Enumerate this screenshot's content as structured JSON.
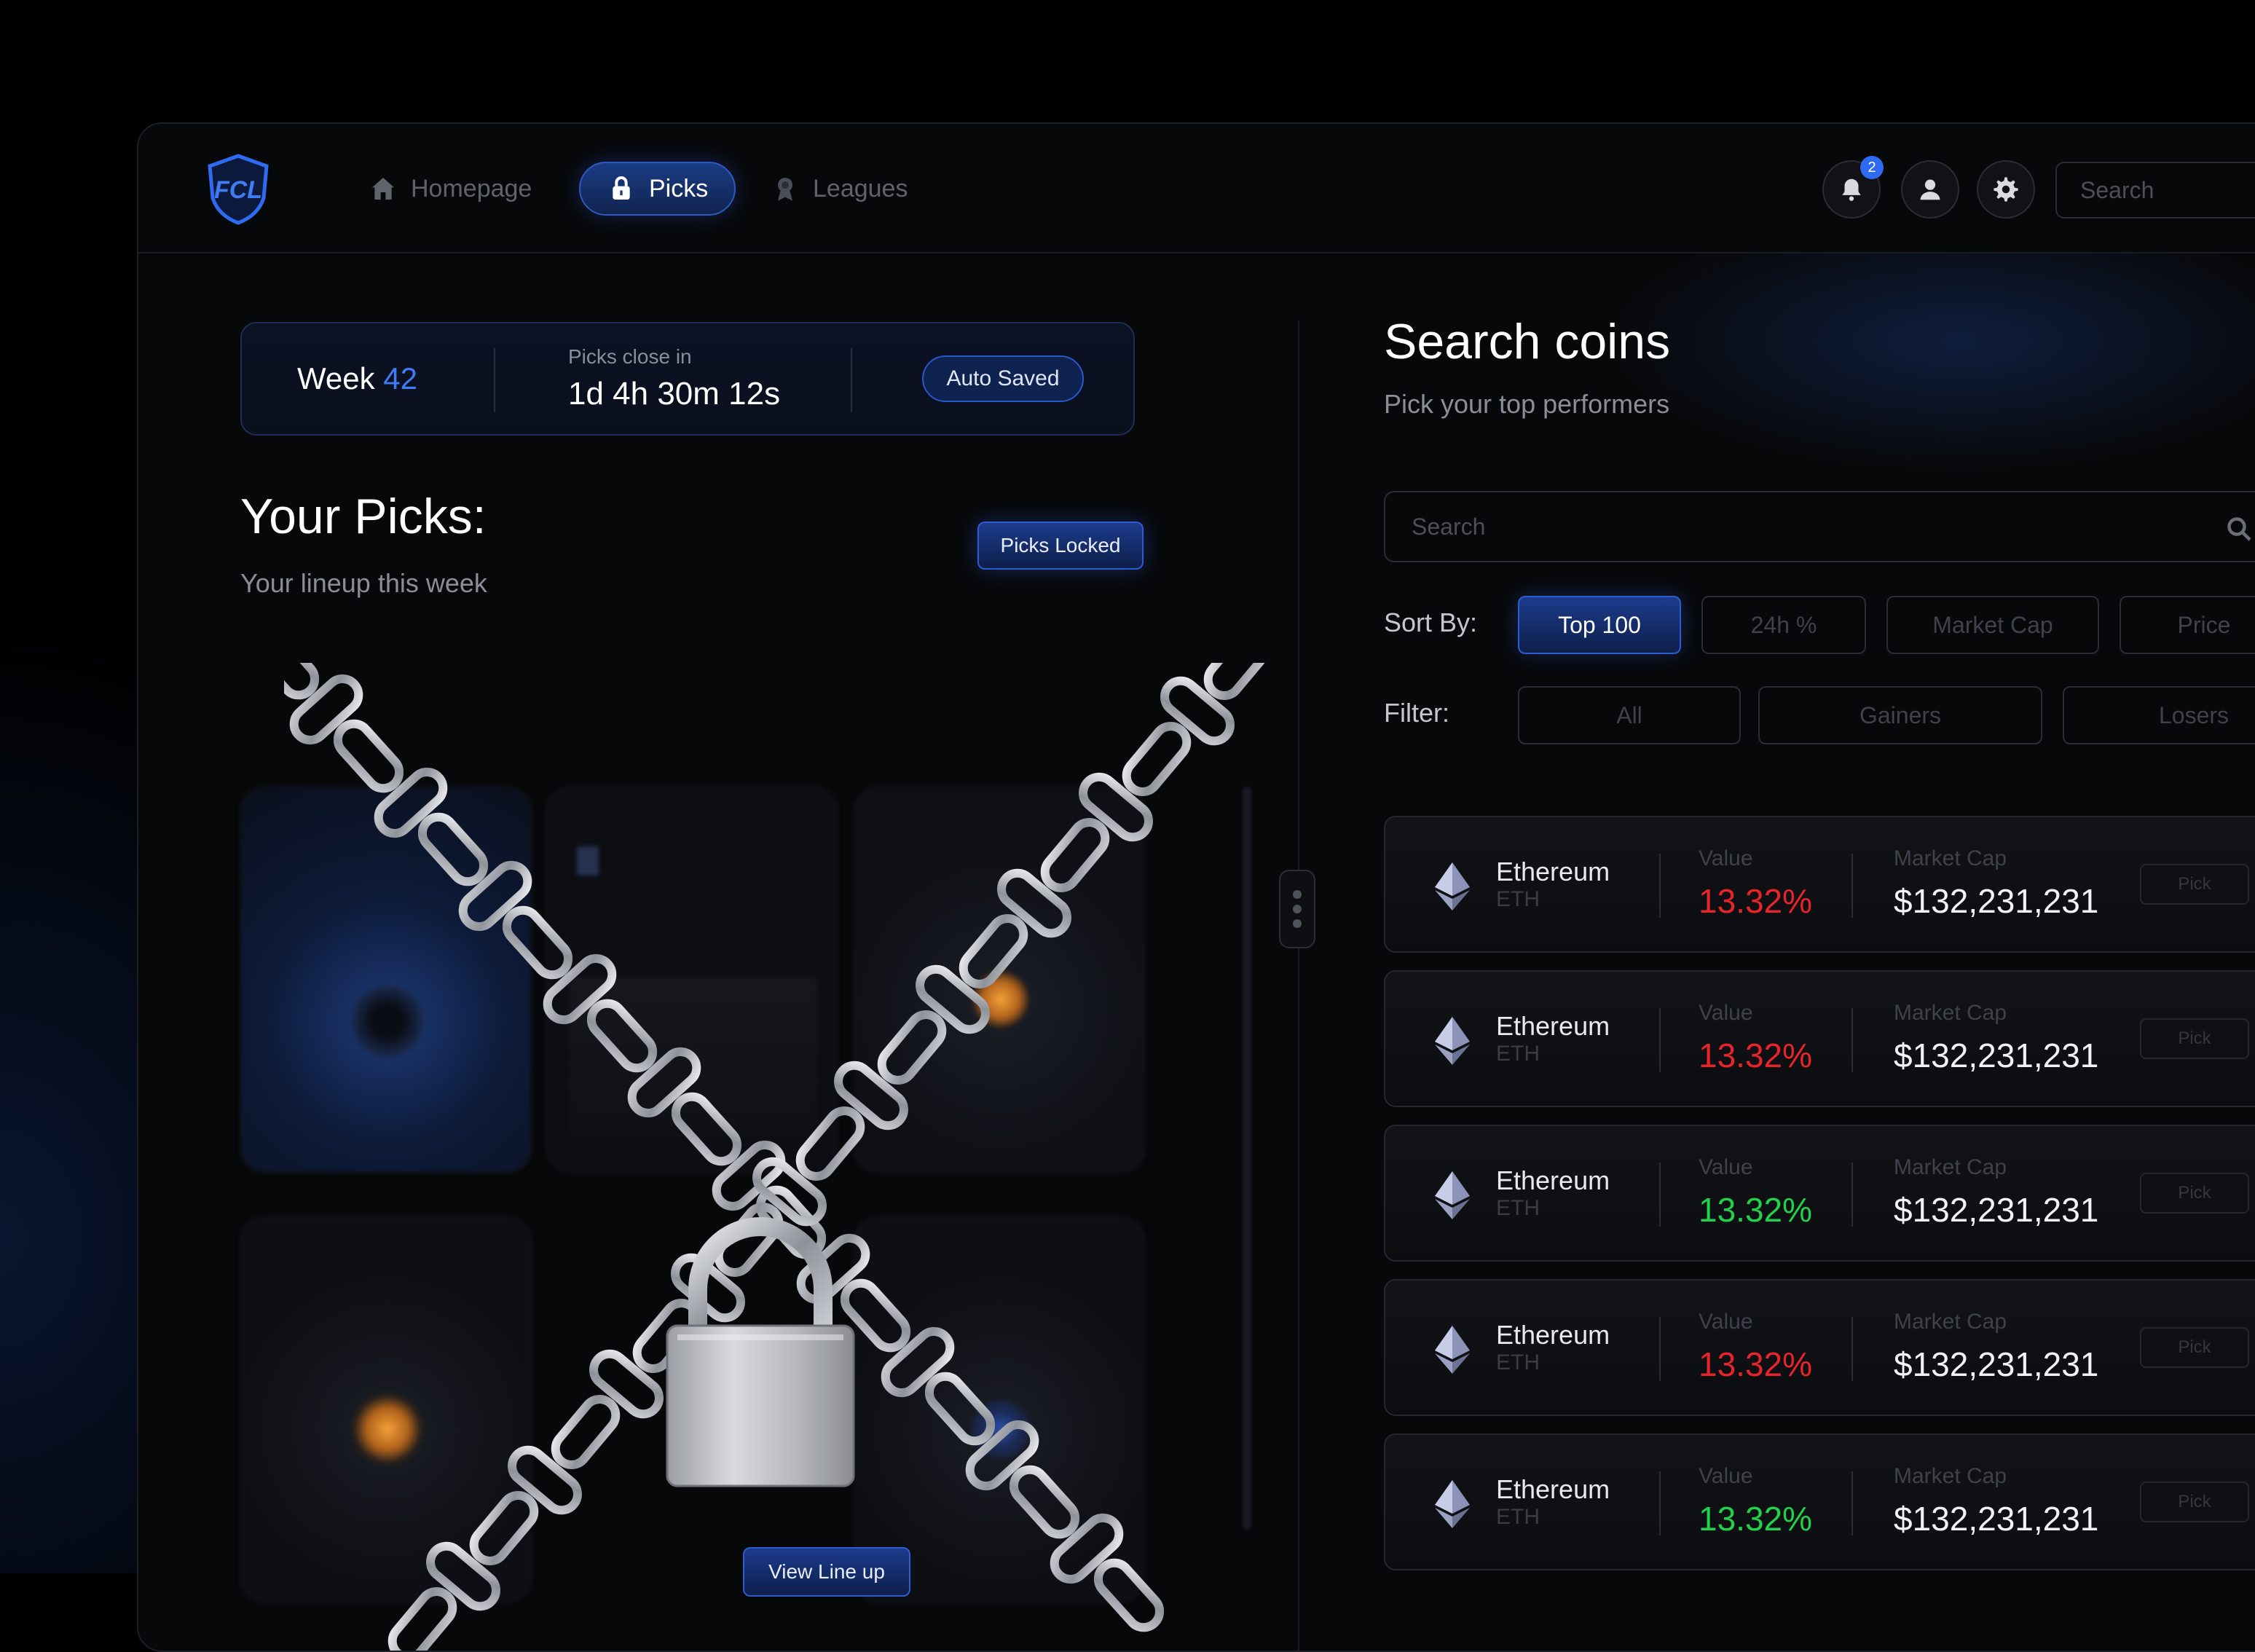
{
  "app": {
    "logo_text": "FCL",
    "brand_color": "#2f6bf2"
  },
  "nav": {
    "items": [
      {
        "label": "Homepage",
        "icon": "home-icon",
        "active": false
      },
      {
        "label": "Picks",
        "icon": "lock-icon",
        "active": true
      },
      {
        "label": "Leagues",
        "icon": "award-icon",
        "active": false
      }
    ],
    "notifications_count": "2",
    "search_placeholder": "Search"
  },
  "week_bar": {
    "week_word": "Week",
    "week_number": "42",
    "close_label": "Picks close in",
    "close_time": "1d 4h 30m 12s",
    "autosaved": "Auto Saved"
  },
  "picks": {
    "title": "Your Picks:",
    "subtitle": "Your lineup this week",
    "locked_label": "Picks Locked",
    "view_lineup": "View Line up"
  },
  "coins_panel": {
    "title": "Search coins",
    "subtitle": "Pick your top performers",
    "search_placeholder": "Search",
    "sort_label": "Sort By:",
    "sort_options": [
      {
        "label": "Top 100",
        "active": true
      },
      {
        "label": "24h %",
        "active": false
      },
      {
        "label": "Market Cap",
        "active": false
      },
      {
        "label": "Price",
        "active": false
      }
    ],
    "filter_label": "Filter:",
    "filter_options": [
      {
        "label": "All",
        "active": false
      },
      {
        "label": "Gainers",
        "active": false
      },
      {
        "label": "Losers",
        "active": false
      }
    ],
    "value_label": "Value",
    "cap_label": "Market Cap",
    "pick_label": "Pick",
    "colors": {
      "up": "#22d14a",
      "down": "#e8242b"
    },
    "rows": [
      {
        "name": "Ethereum",
        "ticker": "ETH",
        "value": "13.32%",
        "trend": "down",
        "market_cap": "$132,231,231"
      },
      {
        "name": "Ethereum",
        "ticker": "ETH",
        "value": "13.32%",
        "trend": "down",
        "market_cap": "$132,231,231"
      },
      {
        "name": "Ethereum",
        "ticker": "ETH",
        "value": "13.32%",
        "trend": "up",
        "market_cap": "$132,231,231"
      },
      {
        "name": "Ethereum",
        "ticker": "ETH",
        "value": "13.32%",
        "trend": "down",
        "market_cap": "$132,231,231"
      },
      {
        "name": "Ethereum",
        "ticker": "ETH",
        "value": "13.32%",
        "trend": "up",
        "market_cap": "$132,231,231"
      }
    ]
  }
}
